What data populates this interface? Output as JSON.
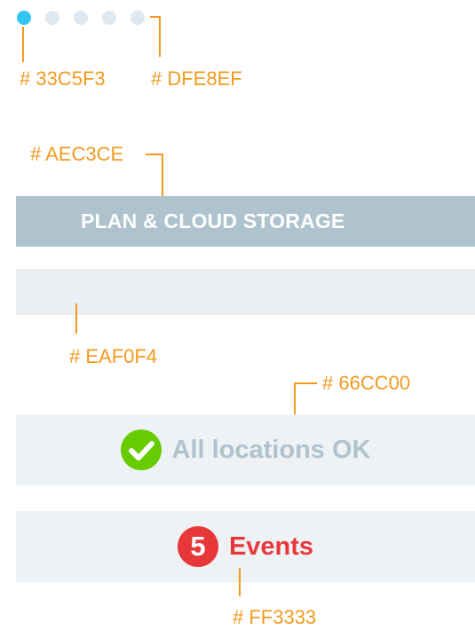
{
  "pagination": {
    "dots": [
      {
        "state": "active",
        "color": "#33C5F3"
      },
      {
        "state": "inactive",
        "color": "#DFE8EF"
      },
      {
        "state": "inactive",
        "color": "#DFE8EF"
      },
      {
        "state": "inactive",
        "color": "#DFE8EF"
      },
      {
        "state": "inactive",
        "color": "#DFE8EF"
      }
    ]
  },
  "annotations": {
    "active_dot": "# 33C5F3",
    "inactive_dot": "# DFE8EF",
    "plan_bar": "# AEC3CE",
    "empty_bar": "# EAF0F4",
    "status_icon": "# 66CC00",
    "events_badge": "# FF3333"
  },
  "plan": {
    "label": "PLAN & CLOUD STORAGE",
    "color": "#AEC3CE"
  },
  "empty_bar": {
    "color": "#EAF0F4"
  },
  "status": {
    "icon": "checkmark-circle-icon",
    "icon_color": "#66CC00",
    "text": "All locations OK",
    "text_color": "#AEC3CE"
  },
  "events": {
    "count": "5",
    "label": "Events",
    "color": "#FF3333"
  },
  "annotation_color": "#F29A1F"
}
